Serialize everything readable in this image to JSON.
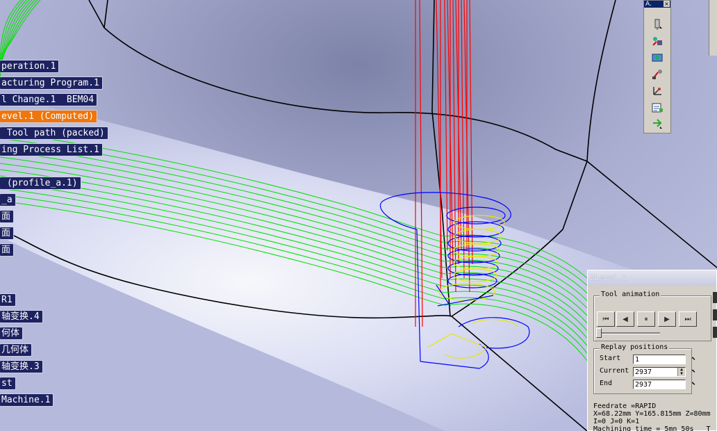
{
  "tree": {
    "items": [
      {
        "label": "peration.1",
        "selected": false
      },
      {
        "label": "acturing Program.1",
        "selected": false
      },
      {
        "label": "l Change.1  BEM04",
        "selected": false
      },
      {
        "label": "evel.1 (Computed)",
        "selected": true
      },
      {
        "label": " Tool path (packed)",
        "selected": false
      },
      {
        "label": "ing Process List.1",
        "selected": false
      },
      {
        "label": " (profile_a.1)",
        "selected": false
      },
      {
        "label": "_a",
        "selected": false
      },
      {
        "label": "面",
        "selected": false
      },
      {
        "label": "面",
        "selected": false
      },
      {
        "label": "面",
        "selected": false
      },
      {
        "label": "R1",
        "selected": false
      },
      {
        "label": "轴变换.4",
        "selected": false
      },
      {
        "label": "何体",
        "selected": false
      },
      {
        "label": "几何体",
        "selected": false
      },
      {
        "label": "轴变换.3",
        "selected": false
      },
      {
        "label": "st",
        "selected": false
      },
      {
        "label": "Machine.1",
        "selected": false
      }
    ]
  },
  "toolbar": {
    "title": "A.",
    "close": "×",
    "icons": [
      "tool-display-icon",
      "tool-path-replay-icon",
      "simulation-icon",
      "video-icon",
      "multi-axis-icon",
      "report-icon",
      "insert-icon"
    ]
  },
  "dialog": {
    "title": "ZLevel.1",
    "tool_animation": {
      "legend": "Tool animation",
      "buttons": [
        "⏮",
        "◀",
        "⏸",
        "▶",
        "⏭"
      ]
    },
    "replay_positions": {
      "legend": "Replay positions",
      "start_label": "Start",
      "start_value": "1",
      "current_label": "Current",
      "current_value": "2937",
      "end_label": "End",
      "end_value": "2937"
    },
    "feedrate": "Feedrate =RAPID",
    "coords": "X=68.22mm Y=165.815mm Z=80mm",
    "ijk": "I=0 J=0 K=1",
    "machining_time": "Machining time = 5mn 50s   T"
  },
  "colors": {
    "background": "#b9bedc",
    "tree_label_bg": "#1d2360",
    "tree_selected_bg": "#f0750a",
    "toolpath_green": "#00e000",
    "tool_red": "#ff0000",
    "tool_blue": "#0000ff",
    "tool_yellow": "#e8e800"
  }
}
